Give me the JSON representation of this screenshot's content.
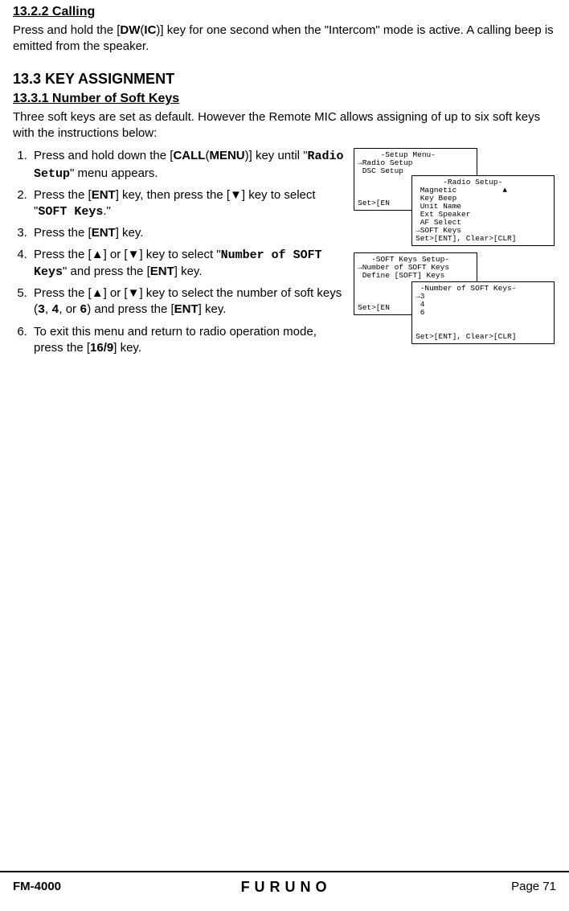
{
  "section_1322": {
    "heading": "13.2.2  Calling",
    "p1_a": "Press and hold the [",
    "p1_dw": "DW",
    "p1_paren_open": "(",
    "p1_ic": "IC",
    "p1_paren_close": ")",
    "p1_b": "] key for one second when the \"Intercom\" mode is active. A calling beep is emitted from the speaker."
  },
  "section_133": {
    "heading": "13.3   KEY ASSIGNMENT"
  },
  "section_1331": {
    "heading": "13.3.1  Number of Soft Keys",
    "intro": "Three soft keys are set as default. However the Remote MIC allows assigning of up to six soft keys with the instructions below:"
  },
  "steps": {
    "s1_a": "Press and hold down the [",
    "s1_call": "CALL",
    "s1_paren_open": "(",
    "s1_menu": "MENU",
    "s1_paren_close": ")",
    "s1_b": "] key until \"",
    "s1_radio_setup": "Radio Setup",
    "s1_c": "\" menu appears.",
    "s2_a": "Press the [",
    "s2_ent": "ENT",
    "s2_b": "] key, then press the [",
    "s2_c": "] key to select \"",
    "s2_soft_keys": "SOFT Keys",
    "s2_d": ".\"",
    "s3_a": "Press the [",
    "s3_ent": "ENT",
    "s3_b": "] key.",
    "s4_a": "Press the [",
    "s4_b": "] or [",
    "s4_c": "] key to select \"",
    "s4_num": "Number of SOFT Keys",
    "s4_d": "\" and press the [",
    "s4_ent": "ENT",
    "s4_e": "] key.",
    "s5_a": "Press the [",
    "s5_b": "] or [",
    "s5_c": "] key to select the number of soft keys (",
    "s5_3": "3",
    "s5_comma1": ", ",
    "s5_4": "4",
    "s5_comma2": ", or ",
    "s5_6": "6",
    "s5_d": ") and press the [",
    "s5_ent": "ENT",
    "s5_e": "] key.",
    "s6_a": "To exit this menu and return to radio operation mode, press the [",
    "s6_169": "16/9",
    "s6_b": "] key."
  },
  "lcd": {
    "setup_menu": "     -Setup Menu-\n→Radio Setup\n DSC Setup\n\n\n\nSet>[EN",
    "radio_setup": "      -Radio Setup-\n Magnetic          ▲\n Key Beep\n Unit Name\n Ext Speaker\n AF Select\n→SOFT Keys\nSet>[ENT], Clear>[CLR]",
    "soft_keys_setup": "   -SOFT Keys Setup-\n→Number of SOFT Keys\n Define [SOFT] Keys\n\n\n\nSet>[EN",
    "number_soft_keys": " -Number of SOFT Keys-\n→3\n 4\n 6\n\n\nSet>[ENT], Clear>[CLR]"
  },
  "footer": {
    "model": "FM-4000",
    "brand": "FURUNO",
    "page": "Page 71"
  }
}
